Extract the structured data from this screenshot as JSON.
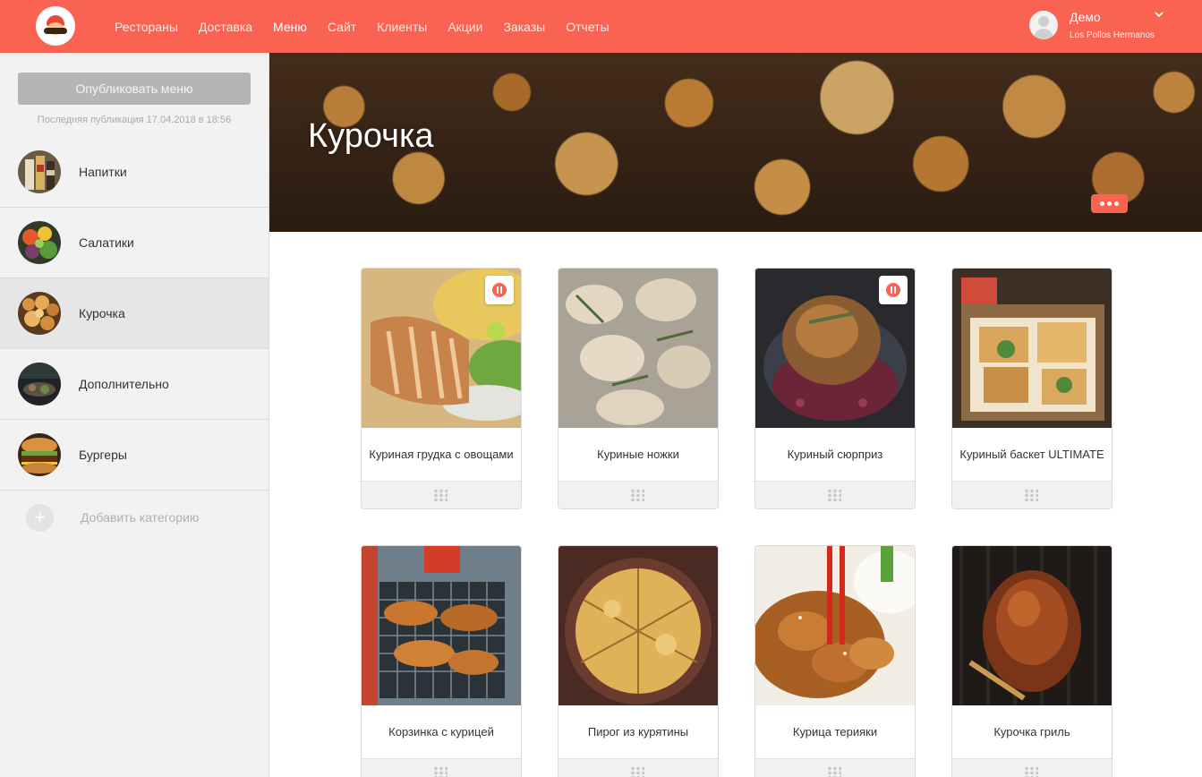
{
  "nav": {
    "logo_icon": "sombrero-mustache-logo-icon",
    "items": [
      {
        "label": "Рестораны",
        "active": false
      },
      {
        "label": "Доставка",
        "active": false
      },
      {
        "label": "Меню",
        "active": true
      },
      {
        "label": "Сайт",
        "active": false
      },
      {
        "label": "Клиенты",
        "active": false
      },
      {
        "label": "Акции",
        "active": false
      },
      {
        "label": "Заказы",
        "active": false
      },
      {
        "label": "Отчеты",
        "active": false
      }
    ],
    "user": {
      "name": "Демо",
      "company": "Los Pollos Hermanos",
      "avatar_icon": "user-avatar-icon",
      "dropdown_icon": "chevron-down-icon"
    }
  },
  "sidebar": {
    "publish_button": "Опубликовать меню",
    "last_publication": "Последняя публикация 17.04.2018 в 18:56",
    "categories": [
      {
        "label": "Напитки",
        "active": false
      },
      {
        "label": "Салатики",
        "active": false
      },
      {
        "label": "Курочка",
        "active": true
      },
      {
        "label": "Дополнительно",
        "active": false
      },
      {
        "label": "Бургеры",
        "active": false
      }
    ],
    "add_category": "Добавить категорию"
  },
  "banner": {
    "title": "Курочка",
    "more_icon": "more-dots-icon"
  },
  "items": [
    {
      "name": "Куриная грудка с овощами",
      "paused": true
    },
    {
      "name": "Куриные ножки",
      "paused": false
    },
    {
      "name": "Куриный сюрприз",
      "paused": true
    },
    {
      "name": "Куриный баскет ULTIMATE",
      "paused": false
    },
    {
      "name": "Корзинка с курицей",
      "paused": false
    },
    {
      "name": "Пирог из курятины",
      "paused": false
    },
    {
      "name": "Курица терияки",
      "paused": false
    },
    {
      "name": "Курочка гриль",
      "paused": false
    }
  ],
  "colors": {
    "accent": "#fa6352",
    "sidebar_bg": "#f2f2f2",
    "active_category_bg": "#e6e6e6"
  }
}
